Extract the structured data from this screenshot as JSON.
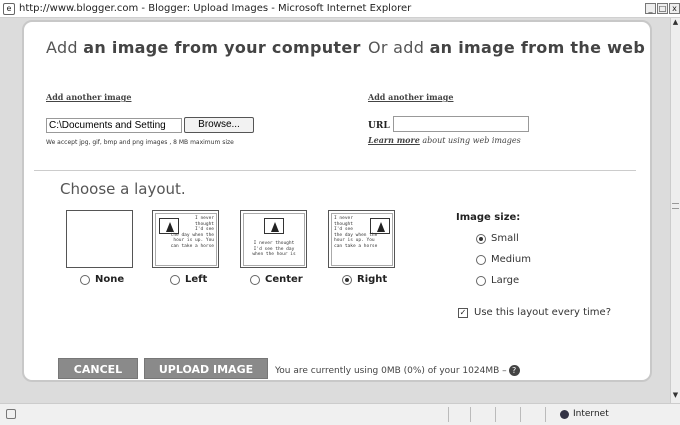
{
  "window": {
    "title": "http://www.blogger.com - Blogger: Upload Images - Microsoft Internet Explorer"
  },
  "computer": {
    "heading_prefix": "Add ",
    "heading_bold": "an image from your computer",
    "add_another": "Add another image",
    "file_value": "C:\\Documents and Setting",
    "browse_label": "Browse...",
    "accept_text": "We accept jpg, gif, bmp and png images , 8 MB maximum size"
  },
  "web": {
    "heading_prefix": "Or add ",
    "heading_bold": "an image from the web",
    "add_another": "Add another image",
    "url_label": "URL",
    "url_value": "",
    "learn_more": "Learn more",
    "learn_rest": " about using web images"
  },
  "layout": {
    "title": "Choose a layout.",
    "thumb_text_left": "I never\nthought\nI'd see\nthe day when the\nhour is up. You\ncan take a horse",
    "thumb_text_center": "I never thought\nI'd see the day\nwhen the hour is",
    "thumb_text_right": "I never\nthought\nI'd see\nthe day when the\nhour is up. You\ncan take a horse",
    "options": [
      {
        "label": "None",
        "selected": false
      },
      {
        "label": "Left",
        "selected": false
      },
      {
        "label": "Center",
        "selected": false
      },
      {
        "label": "Right",
        "selected": true
      }
    ]
  },
  "size": {
    "title": "Image size:",
    "options": [
      {
        "label": "Small",
        "selected": true
      },
      {
        "label": "Medium",
        "selected": false
      },
      {
        "label": "Large",
        "selected": false
      }
    ],
    "remember_label": "Use this layout every time?",
    "remember_checked": true
  },
  "actions": {
    "cancel_label": "CANCEL",
    "upload_label": "UPLOAD IMAGE",
    "usage_text": "You are currently using 0MB (0%) of your 1024MB –"
  },
  "status": {
    "zone": "Internet"
  }
}
